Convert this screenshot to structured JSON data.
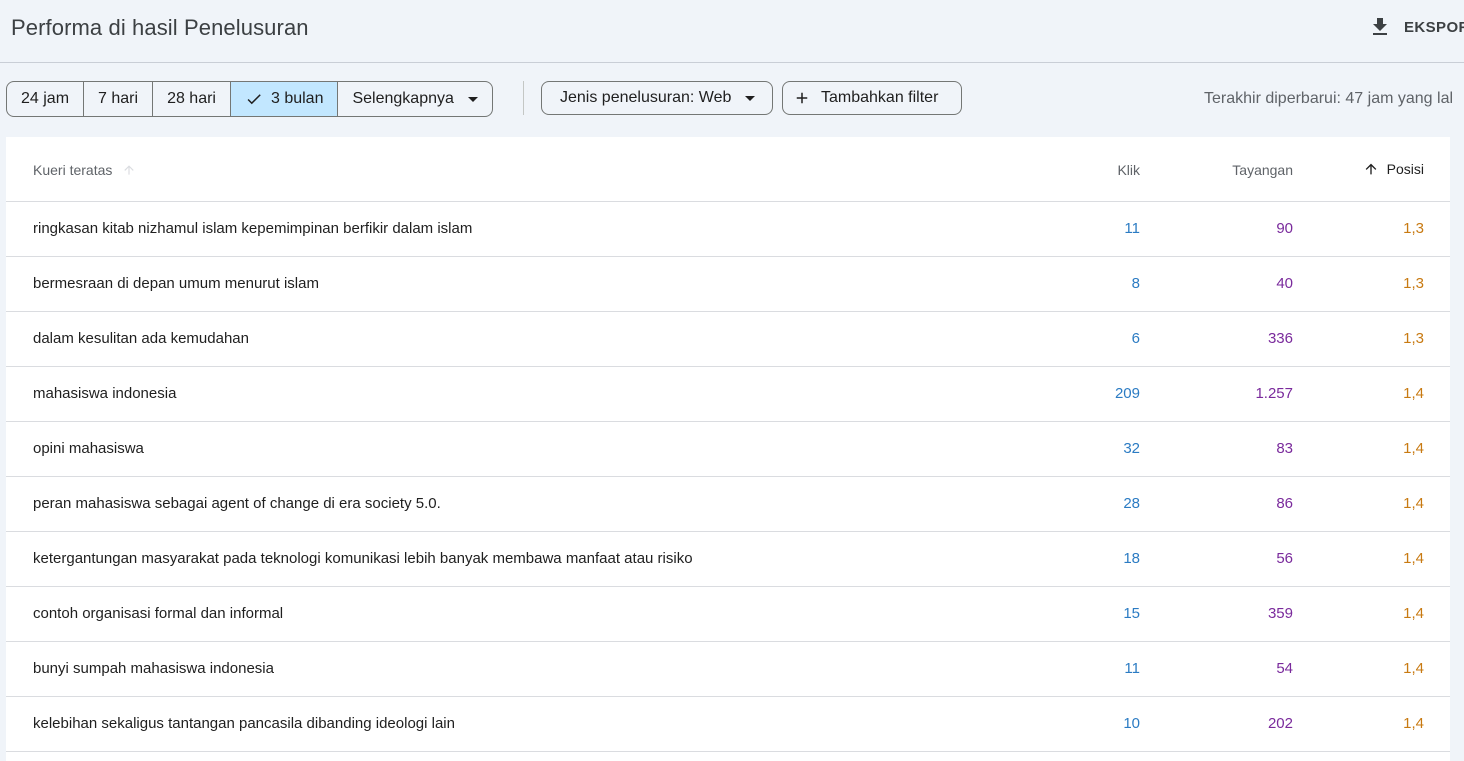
{
  "header": {
    "title": "Performa di hasil Penelusuran",
    "export_label": "EKSPOR"
  },
  "filters": {
    "ranges": [
      {
        "label": "24 jam"
      },
      {
        "label": "7 hari"
      },
      {
        "label": "28 hari"
      },
      {
        "label": "3 bulan",
        "active": true
      },
      {
        "label": "Selengkapnya"
      }
    ],
    "search_type": "Jenis penelusuran: Web",
    "add_filter": "Tambahkan filter",
    "last_updated": "Terakhir diperbarui: 47 jam yang lal"
  },
  "table": {
    "columns": {
      "query": "Kueri teratas",
      "clicks": "Klik",
      "impressions": "Tayangan",
      "position": "Posisi"
    },
    "rows": [
      {
        "query": "ringkasan kitab nizhamul islam kepemimpinan berfikir dalam islam",
        "clicks": "11",
        "impressions": "90",
        "position": "1,3"
      },
      {
        "query": "bermesraan di depan umum menurut islam",
        "clicks": "8",
        "impressions": "40",
        "position": "1,3"
      },
      {
        "query": "dalam kesulitan ada kemudahan",
        "clicks": "6",
        "impressions": "336",
        "position": "1,3"
      },
      {
        "query": "mahasiswa indonesia",
        "clicks": "209",
        "impressions": "1.257",
        "position": "1,4"
      },
      {
        "query": "opini mahasiswa",
        "clicks": "32",
        "impressions": "83",
        "position": "1,4"
      },
      {
        "query": "peran mahasiswa sebagai agent of change di era society 5.0.",
        "clicks": "28",
        "impressions": "86",
        "position": "1,4"
      },
      {
        "query": "ketergantungan masyarakat pada teknologi komunikasi lebih banyak membawa manfaat atau risiko",
        "clicks": "18",
        "impressions": "56",
        "position": "1,4"
      },
      {
        "query": "contoh organisasi formal dan informal",
        "clicks": "15",
        "impressions": "359",
        "position": "1,4"
      },
      {
        "query": "bunyi sumpah mahasiswa indonesia",
        "clicks": "11",
        "impressions": "54",
        "position": "1,4"
      },
      {
        "query": "kelebihan sekaligus tantangan pancasila dibanding ideologi lain",
        "clicks": "10",
        "impressions": "202",
        "position": "1,4"
      }
    ]
  },
  "colors": {
    "clicks": "#2b7bc3",
    "impressions": "#7a2a9c",
    "position": "#c87a12",
    "active_chip": "#c2e7ff"
  }
}
